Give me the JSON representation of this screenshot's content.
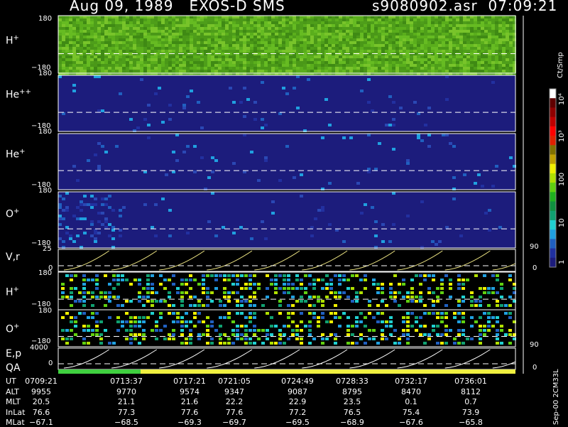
{
  "header": {
    "left_title": "Aug 09, 1989   EXOS-D SMS",
    "right_title": "s9080902.asr  07:09:21"
  },
  "chart_data": {
    "type": "heatmap",
    "panels": [
      {
        "label_base": "H",
        "label_sup": "+",
        "ymax": "180",
        "ymin": "−180",
        "level": "high"
      },
      {
        "label_base": "He",
        "label_sup": "++",
        "ymax": "180",
        "ymin": "−180",
        "level": "low"
      },
      {
        "label_base": "He",
        "label_sup": "+",
        "ymax": "180",
        "ymin": "−180",
        "level": "low"
      },
      {
        "label_base": "O",
        "label_sup": "+",
        "ymax": "180",
        "ymin": "−180",
        "level": "low"
      }
    ],
    "vr_panel": {
      "label": "V,r",
      "ymax": "25",
      "ymin": "0",
      "right_max": "90",
      "right_min": "0"
    },
    "pitch_panels": [
      {
        "label_base": "H",
        "label_sup": "+",
        "ymax": "180",
        "ymin": "−180"
      },
      {
        "label_base": "O",
        "label_sup": "+",
        "ymax": "180",
        "ymin": "−180"
      }
    ],
    "ep_panel": {
      "label": "E,p",
      "ymax": "4000",
      "ymin": "0",
      "right_max": "90",
      "right_min": "0"
    },
    "qa_label": "QA",
    "colorbar": {
      "unit": "Ct/Smp",
      "ticks": [
        "1",
        "10",
        "100",
        "10³",
        "10⁴"
      ],
      "colors": [
        "#1c1c7c",
        "#2030a0",
        "#2060c0",
        "#20a0e0",
        "#20d0d0",
        "#10a070",
        "#109040",
        "#20b020",
        "#60d010",
        "#b0e000",
        "#f0f000",
        "#c0a000",
        "#807000",
        "#e02000",
        "#ff0000",
        "#c00000",
        "#900000",
        "#600000",
        "#ffffff"
      ]
    },
    "qa_bar": {
      "green_fraction": 0.18,
      "green": "#40d040",
      "yellow": "#f0f040"
    },
    "table": {
      "rows": [
        {
          "label": "UT",
          "values": [
            "0709:21",
            "0713:37",
            "0717:21",
            "0721:05",
            "0724:49",
            "0728:33",
            "0732:17",
            "0736:01"
          ]
        },
        {
          "label": "ALT",
          "values": [
            "9955",
            "9770",
            "9574",
            "9347",
            "9087",
            "8795",
            "8470",
            "8112"
          ]
        },
        {
          "label": "MLT",
          "values": [
            "20.5",
            "21.1",
            "21.6",
            "22.2",
            "22.9",
            "23.5",
            "0.1",
            "0.7"
          ]
        },
        {
          "label": "InLat",
          "values": [
            "76.6",
            "77.3",
            "77.6",
            "77.6",
            "77.2",
            "76.5",
            "75.4",
            "73.9"
          ]
        },
        {
          "label": "MLat",
          "values": [
            "−67.1",
            "−68.5",
            "−69.3",
            "−69.7",
            "−69.5",
            "−68.9",
            "−67.6",
            "−65.8"
          ]
        }
      ]
    },
    "footer_note": "Sep-00 2CM33L"
  }
}
